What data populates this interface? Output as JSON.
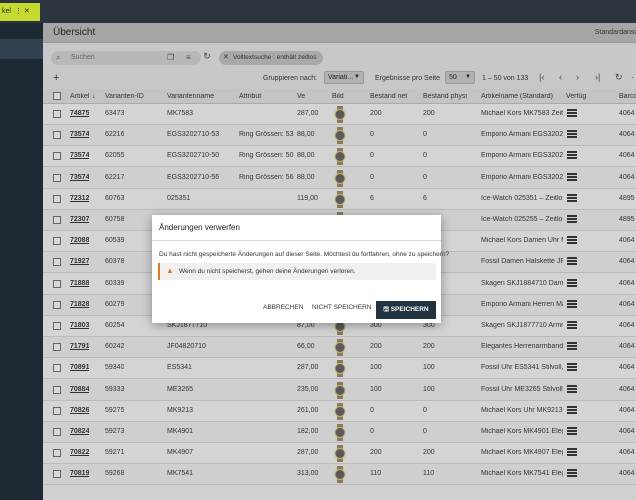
{
  "tabbar": {
    "tab_label": "kel",
    "tab_menu": "⋮",
    "tab_close": "✕"
  },
  "header": {
    "title": "Übersicht",
    "right_text": "Standardansi"
  },
  "filters": {
    "search_placeholder": "Suchen",
    "chip_label": "Volltextsuche : enthält zeitlos"
  },
  "toolbar": {
    "group_label": "Gruppieren nach:",
    "group_value": "Variati...",
    "per_page_label": "Ergebnisse pro Seite",
    "per_page_value": "50",
    "range_text": "1 – 50 von 133"
  },
  "columns": [
    "Artikel",
    "Varianten-ID",
    "Variantenname",
    "Attribut",
    "Ve",
    "Bild",
    "Bestand net",
    "Bestand physi",
    "Artikelname (Standard)",
    "Verfüg",
    "Barco"
  ],
  "rows": [
    {
      "artikel": "74875",
      "vid": "63473",
      "vname": "MK7583",
      "attr": "",
      "ve": "287,00",
      "net": "200",
      "phys": "200",
      "name": "Michael Kors MK7583 Zeitlos",
      "barco": "4064"
    },
    {
      "artikel": "73574",
      "vid": "62216",
      "vname": "EGS3202710-53",
      "attr": "Ring Grössen: 53 (Ri",
      "ve": "88,00",
      "net": "0",
      "phys": "0",
      "name": "Emporio Armani EGS3202710",
      "barco": "4064"
    },
    {
      "artikel": "73574",
      "vid": "62055",
      "vname": "EGS3202710-50",
      "attr": "Ring Grössen: 50 (Ri",
      "ve": "88,00",
      "net": "0",
      "phys": "0",
      "name": "Emporio Armani EGS3202710",
      "barco": "4064"
    },
    {
      "artikel": "73574",
      "vid": "62217",
      "vname": "EGS3202710-56",
      "attr": "Ring Grössen: 56 (Ri",
      "ve": "88,00",
      "net": "0",
      "phys": "0",
      "name": "Emporio Armani EGS3202710",
      "barco": "4064"
    },
    {
      "artikel": "72312",
      "vid": "60763",
      "vname": "025351",
      "attr": "",
      "ve": "119,00",
      "net": "6",
      "phys": "6",
      "name": "Ice-Watch 025351 – Zeitlos",
      "barco": "4895"
    },
    {
      "artikel": "72307",
      "vid": "60758",
      "vname": "",
      "attr": "",
      "ve": "",
      "net": "",
      "phys": "",
      "name": "Ice-Watch 025255 – Zeitlos",
      "barco": "4895"
    },
    {
      "artikel": "72088",
      "vid": "60539",
      "vname": "",
      "attr": "",
      "ve": "",
      "net": "",
      "phys": "",
      "name": "Michael Kors Damen Uhr MK",
      "barco": "4064"
    },
    {
      "artikel": "71927",
      "vid": "60378",
      "vname": "",
      "attr": "",
      "ve": "",
      "net": "",
      "phys": "",
      "name": "Fossil Damen Halskette JF0",
      "barco": "4064"
    },
    {
      "artikel": "71888",
      "vid": "60339",
      "vname": "",
      "attr": "",
      "ve": "",
      "net": "",
      "phys": "",
      "name": "Skagen SKJ1884710 Damen",
      "barco": "4064"
    },
    {
      "artikel": "71828",
      "vid": "60279",
      "vname": "",
      "attr": "",
      "ve": "",
      "net": "",
      "phys": "",
      "name": "Emporio Armani Herren Man",
      "barco": "4064"
    },
    {
      "artikel": "71803",
      "vid": "60254",
      "vname": "SKJ1877710",
      "attr": "",
      "ve": "87,00",
      "net": "300",
      "phys": "300",
      "name": "Skagen SKJ1877710 Armrei",
      "barco": "4064"
    },
    {
      "artikel": "71791",
      "vid": "60242",
      "vname": "JF04820710",
      "attr": "",
      "ve": "66,00",
      "net": "200",
      "phys": "200",
      "name": "Elegantes Herrenarmband F",
      "barco": "4064"
    },
    {
      "artikel": "70891",
      "vid": "59340",
      "vname": "ES5341",
      "attr": "",
      "ve": "287,00",
      "net": "100",
      "phys": "100",
      "name": "Fossil Uhr ES5341 Stilvoll, Z",
      "barco": "4064"
    },
    {
      "artikel": "70884",
      "vid": "59333",
      "vname": "ME3265",
      "attr": "",
      "ve": "235,00",
      "net": "100",
      "phys": "100",
      "name": "Fossil Uhr ME3265 Stilvoller",
      "barco": "4064"
    },
    {
      "artikel": "70826",
      "vid": "59275",
      "vname": "MK9213",
      "attr": "",
      "ve": "261,00",
      "net": "0",
      "phys": "0",
      "name": "Michael Kors Uhr MK9213 El",
      "barco": "4064"
    },
    {
      "artikel": "70824",
      "vid": "59273",
      "vname": "MK4901",
      "attr": "",
      "ve": "182,00",
      "net": "0",
      "phys": "0",
      "name": "Michael Kors MK4901 Elegar",
      "barco": "4064"
    },
    {
      "artikel": "70822",
      "vid": "59271",
      "vname": "MK4907",
      "attr": "",
      "ve": "287,00",
      "net": "200",
      "phys": "200",
      "name": "Michael Kors MK4907 Elegar",
      "barco": "4064"
    },
    {
      "artikel": "70819",
      "vid": "59268",
      "vname": "MK7541",
      "attr": "",
      "ve": "313,00",
      "net": "110",
      "phys": "110",
      "name": "Michael Kors MK7541 Elegar",
      "barco": "4064"
    }
  ],
  "dialog": {
    "title": "Änderungen verwerfen",
    "message": "Du hast nicht gespeicherte Änderungen auf dieser Seite. Möchtest du fortfahren, ohne zu speichern?",
    "warning": "Wenn du nicht speicherst, gehen deine Änderungen verloren.",
    "cancel": "ABBRECHEN",
    "dont_save": "NICHT SPEICHERN",
    "save": "SPEICHERN"
  }
}
